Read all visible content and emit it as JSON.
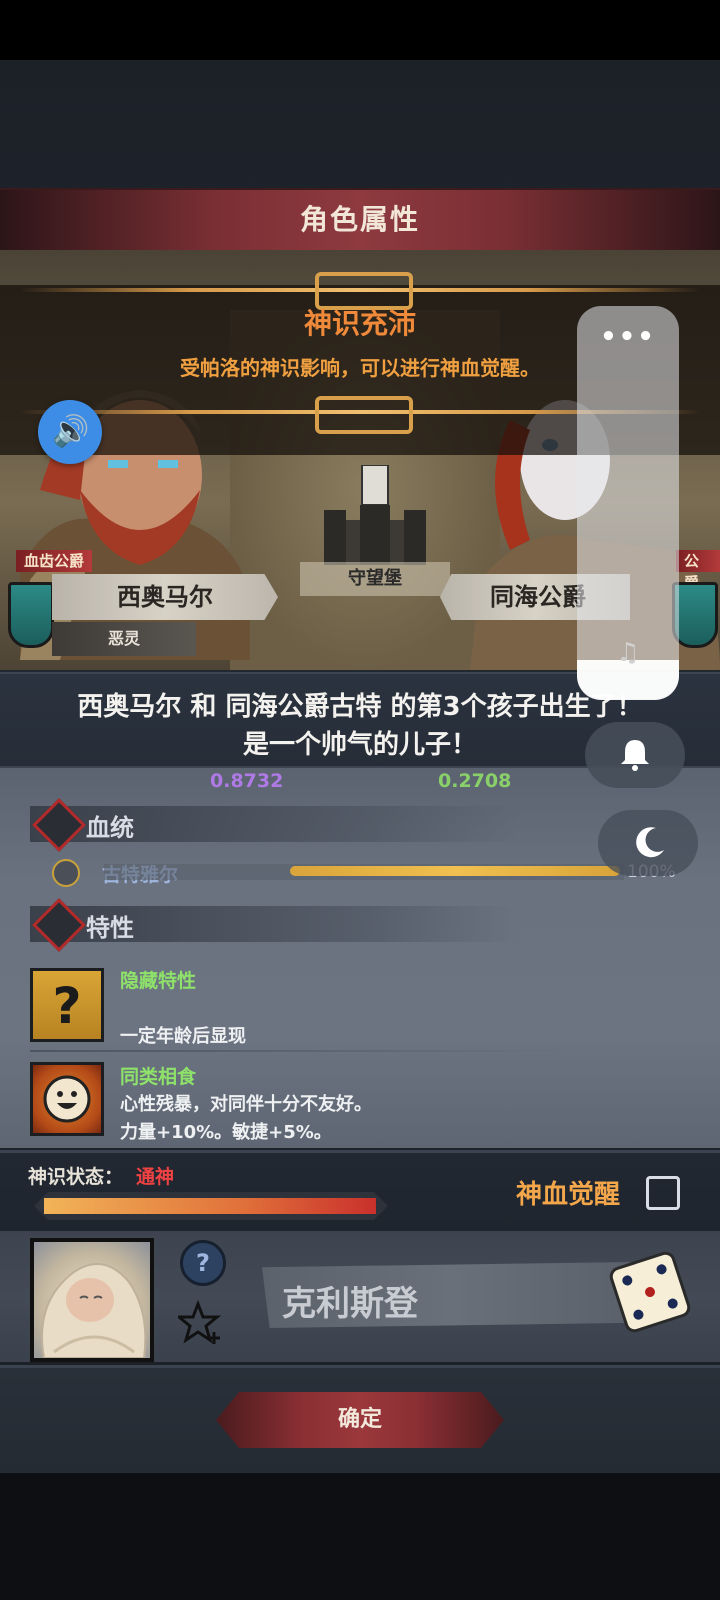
{
  "window": {
    "title": "角色属性"
  },
  "banner": {
    "title": "神识充沛",
    "desc": "受帕洛的神识影响，可以进行神血觉醒。"
  },
  "scene": {
    "location": "守望堡",
    "left_char": {
      "title": "血齿公爵",
      "name": "西奥马尔",
      "trait": "恶灵"
    },
    "right_char": {
      "title": "公爵",
      "name": "同海公爵"
    }
  },
  "announcement": {
    "line1": "西奥马尔 和 同海公爵古特 的第3个孩子出生了！",
    "line2": "是一个帅气的儿子！"
  },
  "stats": {
    "left_value": "0.8732",
    "right_value": "0.2708"
  },
  "lineage": {
    "section": "血统",
    "name": "古特雅尔",
    "percent": "100%",
    "fill": 1.0
  },
  "traits": {
    "section": "特性",
    "items": [
      {
        "name": "隐藏特性",
        "desc1": "",
        "desc2": "一定年龄后显现",
        "icon": "question-mark-icon"
      },
      {
        "name": "同类相食",
        "desc1": "心性残暴，对同伴十分不友好。",
        "desc2": "力量+10%。敏捷+5%。",
        "icon": "smiling-face-icon"
      }
    ]
  },
  "divine": {
    "label": "神识状态：",
    "value": "通神",
    "fill": 1.0,
    "awaken_label": "神血觉醒",
    "awaken_checked": false
  },
  "baby": {
    "name": "克利斯登",
    "help": "?",
    "star": "☆"
  },
  "actions": {
    "confirm": "确定"
  },
  "overlay": {
    "dots": "•••",
    "sound": "🔊",
    "music": "♫",
    "bell": "🔔",
    "moon": "☾"
  },
  "colors": {
    "accent_red": "#8e3a3f",
    "trait_green": "#8ee26a",
    "divine_red": "#f04242",
    "awaken_orange": "#f3a64a"
  }
}
